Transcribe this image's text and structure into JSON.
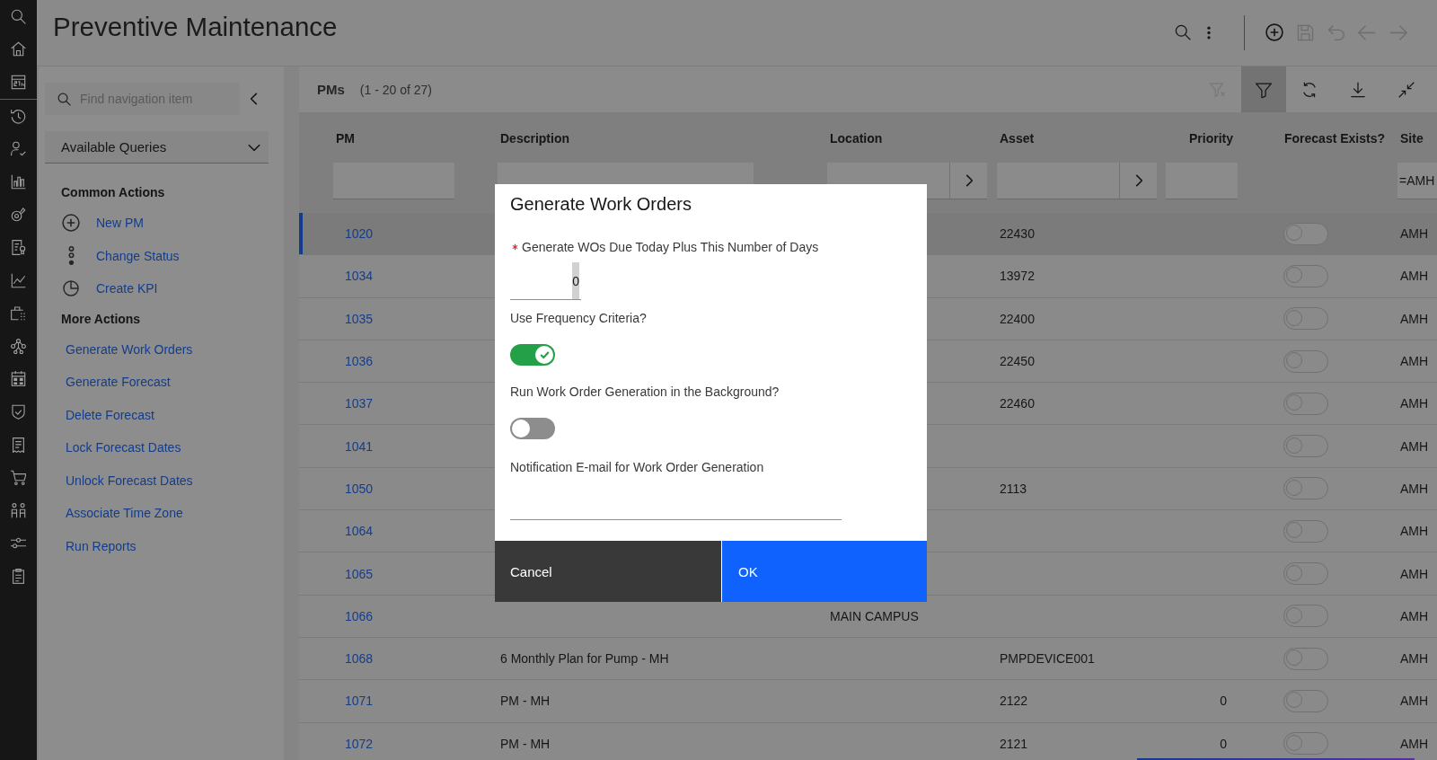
{
  "header": {
    "title": "Preventive Maintenance",
    "actions": [
      {
        "disabled": false
      },
      {
        "disabled": true
      },
      {
        "disabled": true
      },
      {
        "disabled": true
      },
      {
        "disabled": true
      }
    ]
  },
  "navigation": {
    "search": {
      "placeholder": "Find navigation item"
    },
    "query_menu": {
      "label": "Available Queries"
    },
    "common_actions": {
      "heading": "Common Actions",
      "items": [
        {
          "label": "New PM"
        },
        {
          "label": "Change Status"
        },
        {
          "label": "Create KPI"
        }
      ]
    },
    "more_actions": {
      "heading": "More Actions",
      "items": [
        {
          "label": "Generate Work Orders"
        },
        {
          "label": "Generate Forecast"
        },
        {
          "label": "Delete Forecast"
        },
        {
          "label": "Lock Forecast Dates"
        },
        {
          "label": "Unlock Forecast Dates"
        },
        {
          "label": "Associate Time Zone"
        },
        {
          "label": "Run Reports"
        }
      ]
    }
  },
  "table": {
    "title": "PMs",
    "count": "(1 - 20 of 27)",
    "tools": [
      {
        "disabled": true,
        "selected": false
      },
      {
        "disabled": false,
        "selected": true
      },
      {
        "disabled": false,
        "selected": false
      },
      {
        "disabled": false,
        "selected": false
      },
      {
        "disabled": false,
        "selected": false
      }
    ],
    "columns": [
      {
        "label": "PM",
        "kind": "link",
        "filter": {
          "kind": "text"
        }
      },
      {
        "label": "Description",
        "kind": "text",
        "filter": {
          "kind": "text"
        }
      },
      {
        "label": "Location",
        "kind": "text",
        "filter": {
          "kind": "lookup"
        }
      },
      {
        "label": "Asset",
        "kind": "text",
        "filter": {
          "kind": "lookup"
        }
      },
      {
        "label": "Priority",
        "kind": "number",
        "filter": {
          "kind": "text"
        }
      },
      {
        "label": "Forecast Exists?",
        "kind": "toggle"
      },
      {
        "label": "Site",
        "kind": "text",
        "filter": {
          "kind": "text",
          "value": "=AMH"
        }
      }
    ],
    "rows": [
      {
        "pm": "1020",
        "asset": "22430",
        "forecast_exists": false,
        "site": "AMH",
        "selected": true
      },
      {
        "pm": "1034",
        "asset": "13972",
        "forecast_exists": false,
        "site": "AMH",
        "selected": false
      },
      {
        "pm": "1035",
        "asset": "22400",
        "forecast_exists": false,
        "site": "AMH",
        "selected": false
      },
      {
        "pm": "1036",
        "asset": "22450",
        "forecast_exists": false,
        "site": "AMH",
        "selected": false
      },
      {
        "pm": "1037",
        "asset": "22460",
        "forecast_exists": false,
        "site": "AMH",
        "selected": false
      },
      {
        "pm": "1041",
        "forecast_exists": false,
        "site": "AMH",
        "selected": false
      },
      {
        "pm": "1050",
        "asset": "2113",
        "forecast_exists": false,
        "site": "AMH",
        "selected": false
      },
      {
        "pm": "1064",
        "forecast_exists": false,
        "site": "AMH",
        "selected": false
      },
      {
        "pm": "1065",
        "forecast_exists": false,
        "site": "AMH",
        "selected": false
      },
      {
        "pm": "1066",
        "location": "MAIN CAMPUS",
        "forecast_exists": false,
        "site": "AMH",
        "selected": false
      },
      {
        "pm": "1068",
        "description": "6 Monthly Plan for Pump - MH",
        "asset": "PMPDEVICE001",
        "forecast_exists": false,
        "site": "AMH",
        "selected": false
      },
      {
        "pm": "1071",
        "description": "PM - MH",
        "asset": "2122",
        "priority": "0",
        "forecast_exists": false,
        "site": "AMH",
        "selected": false
      },
      {
        "pm": "1072",
        "description": "PM - MH",
        "asset": "2121",
        "priority": "0",
        "forecast_exists": false,
        "site": "AMH",
        "selected": false
      }
    ]
  },
  "dialog": {
    "title": "Generate Work Orders",
    "fields": [
      {
        "kind": "number",
        "label": "Generate WOs Due Today Plus This Number of Days",
        "required": true,
        "value": "0"
      },
      {
        "kind": "toggle",
        "label": "Use Frequency Criteria?",
        "required": false,
        "on": true
      },
      {
        "kind": "toggle",
        "label": "Run Work Order Generation in the Background?",
        "required": false,
        "on": false
      },
      {
        "kind": "email",
        "label": "Notification E-mail for Work Order Generation",
        "required": false
      }
    ],
    "buttons": [
      {
        "kind": "secondary",
        "label": "Cancel"
      },
      {
        "kind": "primary",
        "label": "OK"
      }
    ]
  }
}
